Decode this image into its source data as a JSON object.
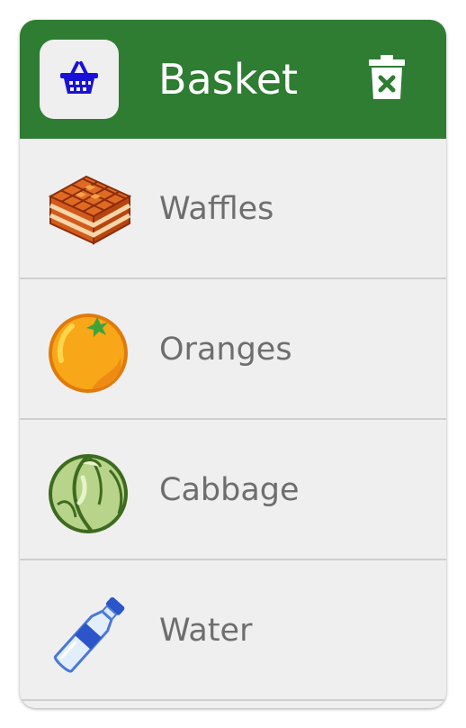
{
  "header": {
    "title": "Basket",
    "basket_icon": "shopping-basket-icon",
    "trash_icon": "delete-basket-icon",
    "background_color": "#2e7d32"
  },
  "items": [
    {
      "label": "Waffles",
      "icon": "waffles-icon"
    },
    {
      "label": "Oranges",
      "icon": "orange-icon"
    },
    {
      "label": "Cabbage",
      "icon": "cabbage-icon"
    },
    {
      "label": "Water",
      "icon": "water-bottle-icon"
    }
  ]
}
